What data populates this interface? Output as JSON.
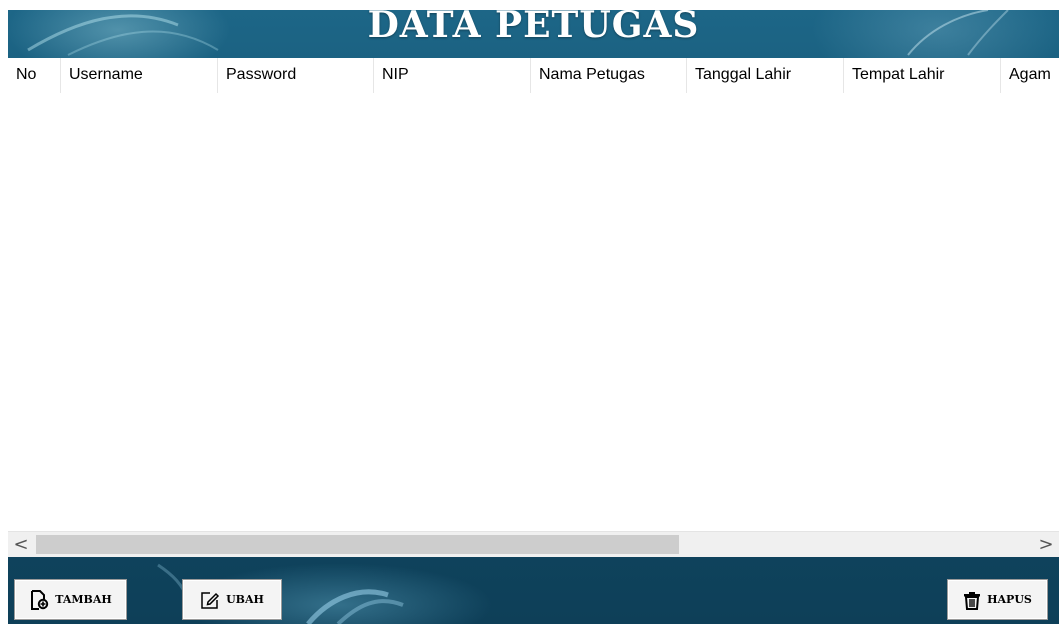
{
  "window": {
    "title": "DATA PETUGAS"
  },
  "table": {
    "columns": [
      "No",
      "Username",
      "Password",
      "NIP",
      "Nama Petugas",
      "Tanggal Lahir",
      "Tempat Lahir",
      "Agam"
    ],
    "rows": []
  },
  "scrollbar": {
    "left_arrow": "<",
    "right_arrow": ">"
  },
  "buttons": {
    "add": {
      "label": "TAMBAH",
      "icon": "add-document-icon"
    },
    "edit": {
      "label": "UBAH",
      "icon": "edit-icon"
    },
    "delete": {
      "label": "HAPUS",
      "icon": "trash-icon"
    }
  },
  "colors": {
    "background": "#12506c",
    "title_text": "#ffffff",
    "button_bg": "#f4f4f4"
  }
}
